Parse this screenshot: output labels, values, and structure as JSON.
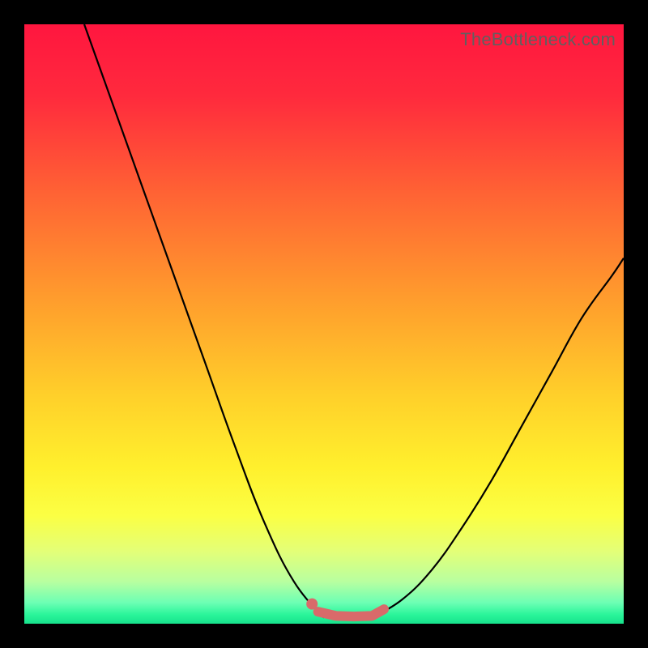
{
  "watermark": "TheBottleneck.com",
  "gradient_stops": [
    {
      "offset": 0.0,
      "color": "#ff163f"
    },
    {
      "offset": 0.12,
      "color": "#ff2a3d"
    },
    {
      "offset": 0.28,
      "color": "#ff6234"
    },
    {
      "offset": 0.45,
      "color": "#ff9a2d"
    },
    {
      "offset": 0.62,
      "color": "#ffd02a"
    },
    {
      "offset": 0.74,
      "color": "#fff02d"
    },
    {
      "offset": 0.82,
      "color": "#fbff44"
    },
    {
      "offset": 0.88,
      "color": "#e3ff78"
    },
    {
      "offset": 0.93,
      "color": "#b8ffa0"
    },
    {
      "offset": 0.965,
      "color": "#6cffb4"
    },
    {
      "offset": 0.985,
      "color": "#2af59a"
    },
    {
      "offset": 1.0,
      "color": "#17e28c"
    }
  ],
  "curve_color": "#000000",
  "marker_color": "#d96a6a",
  "chart_data": {
    "type": "line",
    "title": "",
    "xlabel": "",
    "ylabel": "",
    "xlim": [
      0,
      100
    ],
    "ylim": [
      0,
      100
    ],
    "series": [
      {
        "name": "curve-left",
        "x": [
          10,
          15,
          20,
          25,
          30,
          35,
          40,
          45,
          50
        ],
        "y": [
          100,
          86,
          72,
          58,
          44,
          30,
          17,
          7,
          1
        ]
      },
      {
        "name": "curve-right",
        "x": [
          58,
          63,
          68,
          73,
          78,
          83,
          88,
          93,
          98,
          100
        ],
        "y": [
          1,
          4,
          9,
          16,
          24,
          33,
          42,
          51,
          58,
          61
        ]
      },
      {
        "name": "markers-bottom",
        "x": [
          49,
          52,
          55,
          58,
          60
        ],
        "y": [
          2.0,
          1.3,
          1.2,
          1.3,
          2.4
        ]
      }
    ],
    "marker_point": {
      "x": 48,
      "y": 3.3
    }
  }
}
